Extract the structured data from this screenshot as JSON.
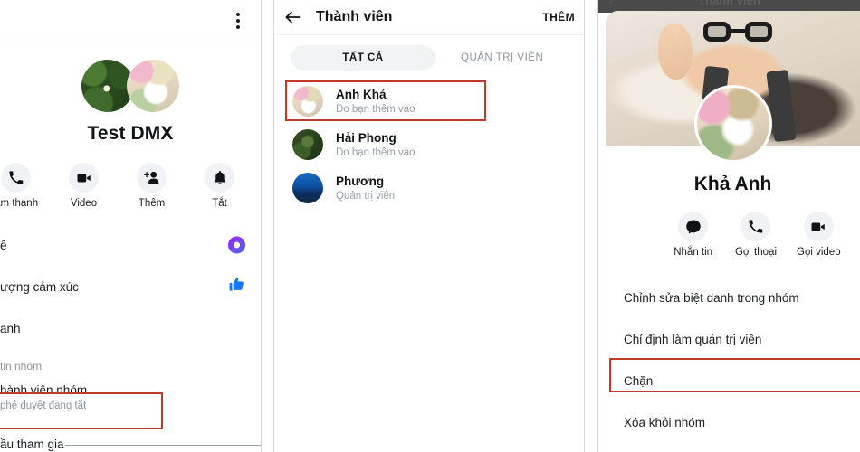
{
  "panel1": {
    "name": "group-info-screen",
    "kebab_icon": "kebab-menu-icon",
    "group_title": "Test DMX",
    "avatars": [
      "lotus-photo-avatar",
      "girl-photo-avatar"
    ],
    "actions": [
      {
        "icon": "phone-icon",
        "label": "Âm thanh"
      },
      {
        "icon": "video-camera-icon",
        "label": "Video"
      },
      {
        "icon": "add-person-icon",
        "label": "Thêm"
      },
      {
        "icon": "bell-icon",
        "label": "Tắt"
      }
    ],
    "rows": [
      {
        "label": "ề",
        "right_icon": "theme-color-dot"
      },
      {
        "label": "ượng cảm xúc",
        "right_icon": "thumbs-up-icon"
      },
      {
        "label": "anh",
        "right_icon": ""
      }
    ],
    "section_label": "tin nhóm",
    "approve_title": "hành viên nhóm",
    "approve_sub": "phê duyệt đang tắt",
    "bottom_label": "ầu tham gia"
  },
  "panel2": {
    "name": "members-list-screen",
    "back_icon": "back-arrow-icon",
    "title": "Thành viên",
    "add_label": "THÊM",
    "tabs": [
      {
        "label": "TẤT CẢ",
        "active": true
      },
      {
        "label": "QUẢN TRỊ VIÊN",
        "active": false
      }
    ],
    "members": [
      {
        "avatar": "anh-kha-avatar",
        "name": "Anh Khả",
        "sub": "Do bạn thêm vào",
        "highlighted": true
      },
      {
        "avatar": "hai-phong-avatar",
        "name": "Hải Phong",
        "sub": "Do bạn thêm vào",
        "highlighted": false
      },
      {
        "avatar": "phuong-avatar",
        "name": "Phương",
        "sub": "Quản trị viên",
        "highlighted": false
      }
    ]
  },
  "panel3": {
    "name": "member-options-sheet",
    "dimmed_header_title": "Thành viên",
    "dimmed_back_icon": "back-arrow-icon",
    "cover_photo": "baby-with-glasses-cover",
    "profile_avatar": "kha-anh-avatar",
    "profile_name": "Khả Anh",
    "actions": [
      {
        "icon": "chat-bubble-icon",
        "label": "Nhắn tin"
      },
      {
        "icon": "phone-icon",
        "label": "Gọi thoại"
      },
      {
        "icon": "video-camera-icon",
        "label": "Gọi video"
      }
    ],
    "menu": [
      {
        "label": "Chỉnh sửa biệt danh trong nhóm",
        "highlighted": false
      },
      {
        "label": "Chỉ định làm quản trị viên",
        "highlighted": false
      },
      {
        "label": "Chặn",
        "highlighted": true
      },
      {
        "label": "Xóa khỏi nhóm",
        "highlighted": false
      }
    ]
  },
  "colors": {
    "highlight": "#c0392b",
    "accent_blue": "#1877f2",
    "text_primary": "#1c1e21",
    "text_secondary": "#8d949e",
    "chip_bg": "#f0f2f5"
  }
}
